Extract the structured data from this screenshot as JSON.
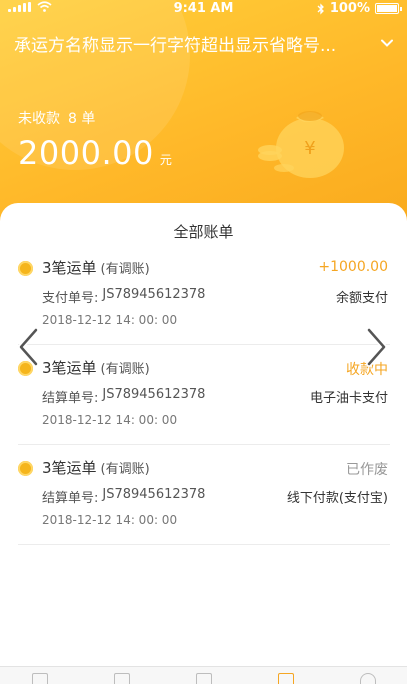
{
  "status_bar": {
    "time": "9:41 AM",
    "battery": "100%"
  },
  "header": {
    "carrier_name": "承运方名称显示一行字符超出显示省略号...",
    "unpaid_label": "未收款",
    "unpaid_count": "8 单",
    "amount": "2000.00",
    "amount_unit": "元"
  },
  "bills": {
    "title": "全部账单",
    "items": [
      {
        "title": "3笔运单",
        "tag": "(有调账)",
        "status": "+1000.00",
        "status_color": "#f5a623",
        "no_label": "支付单号:",
        "no": "JS78945612378",
        "method": "余额支付",
        "date": "2018-12-12  14: 00: 00"
      },
      {
        "title": "3笔运单",
        "tag": "(有调账)",
        "status": "收款中",
        "status_color": "#f5a623",
        "no_label": "结算单号:",
        "no": "JS78945612378",
        "method": "电子油卡支付",
        "date": "2018-12-12  14: 00: 00"
      },
      {
        "title": "3笔运单",
        "tag": "(有调账)",
        "status": "已作废",
        "status_color": "#999999",
        "no_label": "结算单号:",
        "no": "JS78945612378",
        "method": "线下付款(支付宝)",
        "date": "2018-12-12  14: 00: 00"
      }
    ]
  },
  "colors": {
    "accent": "#ffb829",
    "amount_positive": "#f5a623",
    "muted": "#999999"
  },
  "icons": [
    "signal-icon",
    "wifi-icon",
    "bluetooth-icon",
    "battery-icon",
    "chevron-down-icon",
    "money-bag-icon",
    "coin-icon",
    "arrow-left-icon",
    "arrow-right-icon"
  ]
}
